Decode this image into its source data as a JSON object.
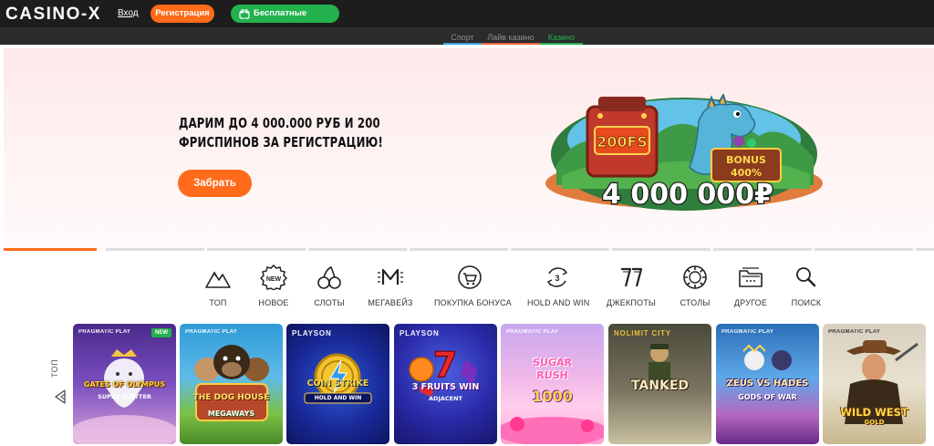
{
  "header": {
    "logo": "CASINO-X",
    "login": "Вход",
    "register": "Регистрация",
    "gifts": "Бесплатные подарки"
  },
  "subnav": {
    "tabs": [
      {
        "label": "Спорт",
        "color": "#3aa0e6"
      },
      {
        "label": "Лайв казино",
        "color": "#f0643c"
      },
      {
        "label": "Казино",
        "color": "#22b14c"
      }
    ],
    "active": "Казино"
  },
  "hero": {
    "title": "ДАРИМ ДО 4 000.000 РУБ И 200 ФРИСПИНОВ ЗА РЕГИСТРАЦИЮ!",
    "button": "Забрать",
    "art": {
      "spins": "200FS",
      "bonus": "BONUS",
      "bonus_pct": "400%",
      "amount": "4 000 000₽"
    },
    "slides_total": 9,
    "slide_active": 1
  },
  "categories": [
    {
      "label": "ТОП",
      "icon": "mountain-icon"
    },
    {
      "label": "НОВОЕ",
      "icon": "new-badge-icon"
    },
    {
      "label": "СЛОТЫ",
      "icon": "cherries-icon"
    },
    {
      "label": "МЕГАВЕЙЗ",
      "icon": "megaways-icon"
    },
    {
      "label": "ПОКУПКА БОНУСА",
      "icon": "bonus-cart-icon"
    },
    {
      "label": "HOLD AND WIN",
      "icon": "hold-and-win-icon"
    },
    {
      "label": "ДЖЕКПОТЫ",
      "icon": "sevens-icon"
    },
    {
      "label": "СТОЛЫ",
      "icon": "chip-icon"
    },
    {
      "label": "ДРУГОЕ",
      "icon": "folder-icon"
    },
    {
      "label": "ПОИСК",
      "icon": "search-icon"
    }
  ],
  "top_label": "ТОП",
  "games": [
    {
      "provider": "PRAGMATIC PLAY",
      "badge": "NEW",
      "title": "GATES OF OLYMPUS",
      "subtitle": "SUPER SCATTER"
    },
    {
      "provider": "PRAGMATIC PLAY",
      "title": "THE DOG HOUSE",
      "subtitle": "MEGAWAYS"
    },
    {
      "provider": "PLAYSON",
      "title": "COIN STRIKE",
      "subtitle": "HOLD AND WIN"
    },
    {
      "provider": "PLAYSON",
      "title": "3 FRUITS WIN",
      "subtitle": "ADJACENT"
    },
    {
      "provider": "PRAGMATIC PLAY",
      "title": "SUGAR RUSH",
      "subtitle": "1000"
    },
    {
      "provider": "NOLIMIT CITY",
      "title": "TANKED"
    },
    {
      "provider": "PRAGMATIC PLAY",
      "title": "ZEUS VS HADES",
      "subtitle": "GODS OF WAR"
    },
    {
      "provider": "PRAGMATIC PLAY",
      "title": "WILD WEST",
      "subtitle": "GOLD"
    }
  ],
  "colors": {
    "accent": "#ff6b1a",
    "green": "#22b14c",
    "topbar": "#1d1d1d"
  }
}
